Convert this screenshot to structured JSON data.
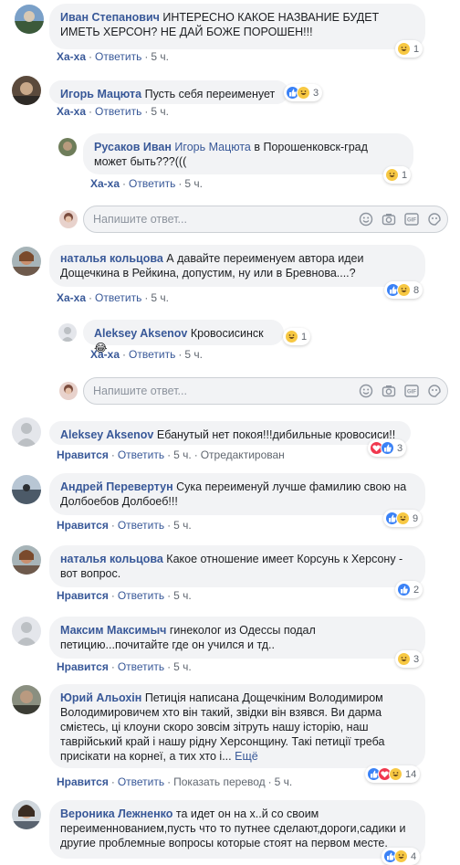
{
  "colors": {
    "link": "#385898",
    "bubble": "#f2f3f5",
    "meta": "#606770",
    "like": "#3b82f6",
    "haha": "#f7c843",
    "love": "#f0384e"
  },
  "reply_placeholder": "Напишите ответ...",
  "labels": {
    "reply": "Ответить",
    "like": "Нравится",
    "haha": "Ха-ха",
    "time5h": "5 ч.",
    "edited": "Отредактирован",
    "translate": "Показать перевод",
    "more": "Ещё"
  },
  "comments": [
    {
      "author": "Иван Степанович",
      "text": "ИНТЕРЕСНО КАКОЕ НАЗВАНИЕ БУДЕТ ИМЕТЬ ХЕРСОН? НЕ ДАЙ БОЖЕ ПОРОШЕН!!!",
      "reaction_label": "Ха-ха",
      "time": "5 ч.",
      "reactions": [
        "haha-icon"
      ],
      "count": "1"
    },
    {
      "author": "Игорь Мацюта",
      "text": "Пусть себя переименует",
      "reaction_label": "Ха-ха",
      "time": "5 ч.",
      "reactions": [
        "like-icon",
        "haha-icon"
      ],
      "count": "3"
    },
    {
      "author": "Русаков Иван",
      "mention": "Игорь Мацюта",
      "text": " в Порошенковск-град может быть???(((",
      "reaction_label": "Ха-ха",
      "time": "5 ч.",
      "reactions": [
        "haha-icon"
      ],
      "count": "1"
    },
    {
      "author": "наталья кольцова",
      "text": "А давайте переименуем автора идеи Дощечкина в Рейкина, допустим, ну или в Бревнова....?",
      "reaction_label": "Ха-ха",
      "time": "5 ч.",
      "reactions": [
        "like-icon",
        "haha-icon"
      ],
      "count": "8"
    },
    {
      "author": "Aleksey Aksenov",
      "text": "Кровосисинск😂",
      "reaction_label": "Ха-ха",
      "time": "5 ч.",
      "reactions": [
        "haha-icon"
      ],
      "count": "1"
    },
    {
      "author": "Aleksey Aksenov",
      "text": "Ебанутый нет покоя!!!дибильные кровосиси!!",
      "reaction_label": "Нравится",
      "time": "5 ч.",
      "edited": "Отредактирован",
      "reactions": [
        "love-icon",
        "like-icon"
      ],
      "count": "3"
    },
    {
      "author": "Андрей Перевертун",
      "text": "Сука переименуй лучше фамилию свою на Долбоебов Долбоеб!!!",
      "reaction_label": "Нравится",
      "time": "5 ч.",
      "reactions": [
        "like-icon",
        "haha-icon"
      ],
      "count": "9"
    },
    {
      "author": "наталья кольцова",
      "text": "Какое отношение имеет Корсунь к Херсону - вот вопрос.",
      "reaction_label": "Нравится",
      "time": "5 ч.",
      "reactions": [
        "like-icon"
      ],
      "count": "2"
    },
    {
      "author": "Максим Максимыч",
      "text": "гинеколог из Одессы подал петицию...почитайте где он учился и тд..",
      "reaction_label": "Нравится",
      "time": "5 ч.",
      "reactions": [
        "haha-icon"
      ],
      "count": "3"
    },
    {
      "author": "Юрий Альохін",
      "text": "Петиція написана Дощечкіним Володимиром Володимировичем хто він такий, звідки він взявся. Ви дарма смієтесь, ці клоуни скоро зовсім зітруть нашу історію, наш таврійський край і нашу рідну Херсонщину. Такі петиції треба присікати на корнеї, а тих хто і...",
      "more": "Ещё",
      "reaction_label": "Нравится",
      "time": "5 ч.",
      "translate": "Показать перевод",
      "reactions": [
        "like-icon",
        "love-icon",
        "haha-icon"
      ],
      "count": "14"
    },
    {
      "author": "Вероника Лежненко",
      "text": "та идет он на х..й со своим переименнованием,пусть что то путнее сделают,дороги,садики и другие проблемные вопросы которые стоят на первом месте.",
      "reactions": [
        "like-icon",
        "haha-icon"
      ],
      "count": "4"
    }
  ]
}
